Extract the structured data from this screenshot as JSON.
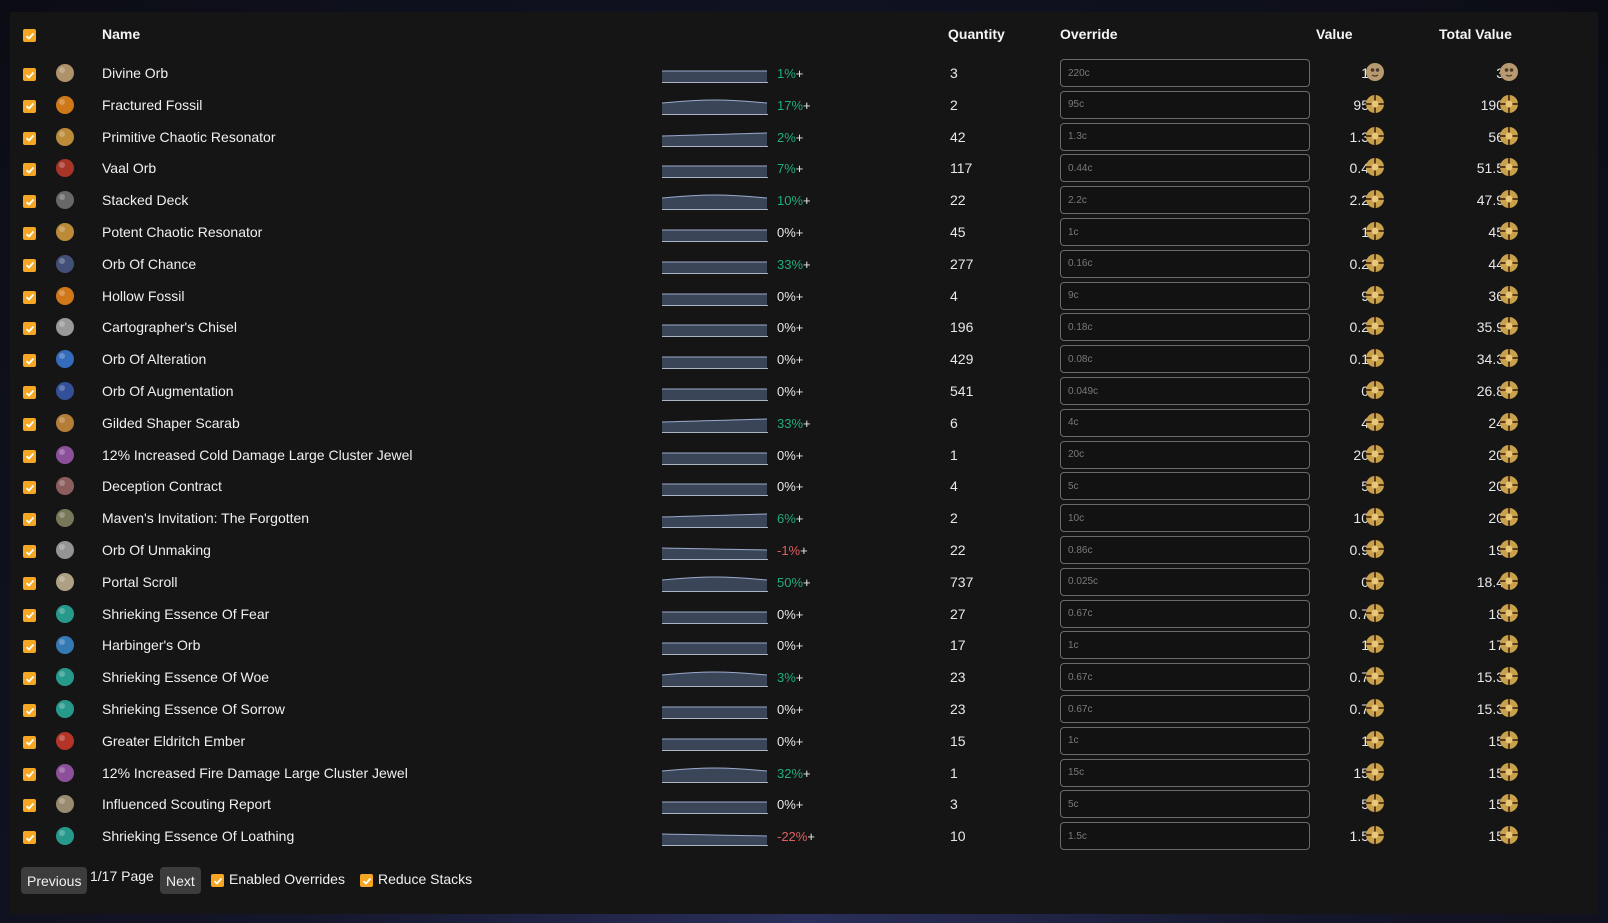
{
  "header": {
    "name": "Name",
    "quantity": "Quantity",
    "override": "Override",
    "value": "Value",
    "total_value": "Total Value"
  },
  "colors": {
    "accent": "#f5a623",
    "positive": "#1fae7a",
    "negative": "#e05d5d"
  },
  "rows": [
    {
      "name": "Divine Orb",
      "icon": "divine-orb-icon",
      "change": "1%",
      "trend": "pos",
      "qty": "3",
      "override": "220c",
      "value": "1",
      "vcur": "divine",
      "total": "3",
      "tcur": "divine"
    },
    {
      "name": "Fractured Fossil",
      "icon": "fossil-icon",
      "change": "17%",
      "trend": "pos",
      "qty": "2",
      "override": "95c",
      "value": "95",
      "vcur": "chaos",
      "total": "190",
      "tcur": "chaos"
    },
    {
      "name": "Primitive Chaotic Resonator",
      "icon": "resonator-icon",
      "change": "2%",
      "trend": "pos",
      "qty": "42",
      "override": "1.3c",
      "value": "1.3",
      "vcur": "chaos",
      "total": "56",
      "tcur": "chaos"
    },
    {
      "name": "Vaal Orb",
      "icon": "vaal-orb-icon",
      "change": "7%",
      "trend": "pos",
      "qty": "117",
      "override": "0.44c",
      "value": "0.4",
      "vcur": "chaos",
      "total": "51.5",
      "tcur": "chaos"
    },
    {
      "name": "Stacked Deck",
      "icon": "card-deck-icon",
      "change": "10%",
      "trend": "pos",
      "qty": "22",
      "override": "2.2c",
      "value": "2.2",
      "vcur": "chaos",
      "total": "47.9",
      "tcur": "chaos"
    },
    {
      "name": "Potent Chaotic Resonator",
      "icon": "resonator-icon",
      "change": "0%",
      "trend": "neu",
      "qty": "45",
      "override": "1c",
      "value": "1",
      "vcur": "chaos",
      "total": "45",
      "tcur": "chaos"
    },
    {
      "name": "Orb Of Chance",
      "icon": "chance-orb-icon",
      "change": "33%",
      "trend": "pos",
      "qty": "277",
      "override": "0.16c",
      "value": "0.2",
      "vcur": "chaos",
      "total": "44",
      "tcur": "chaos"
    },
    {
      "name": "Hollow Fossil",
      "icon": "fossil-icon",
      "change": "0%",
      "trend": "neu",
      "qty": "4",
      "override": "9c",
      "value": "9",
      "vcur": "chaos",
      "total": "36",
      "tcur": "chaos"
    },
    {
      "name": "Cartographer's Chisel",
      "icon": "chisel-icon",
      "change": "0%",
      "trend": "neu",
      "qty": "196",
      "override": "0.18c",
      "value": "0.2",
      "vcur": "chaos",
      "total": "35.9",
      "tcur": "chaos"
    },
    {
      "name": "Orb Of Alteration",
      "icon": "alteration-orb-icon",
      "change": "0%",
      "trend": "neu",
      "qty": "429",
      "override": "0.08c",
      "value": "0.1",
      "vcur": "chaos",
      "total": "34.3",
      "tcur": "chaos"
    },
    {
      "name": "Orb Of Augmentation",
      "icon": "augmentation-orb-icon",
      "change": "0%",
      "trend": "neu",
      "qty": "541",
      "override": "0.049c",
      "value": "0",
      "vcur": "chaos",
      "total": "26.8",
      "tcur": "chaos"
    },
    {
      "name": "Gilded Shaper Scarab",
      "icon": "scarab-icon",
      "change": "33%",
      "trend": "pos",
      "qty": "6",
      "override": "4c",
      "value": "4",
      "vcur": "chaos",
      "total": "24",
      "tcur": "chaos"
    },
    {
      "name": "12% Increased Cold Damage Large Cluster Jewel",
      "icon": "cluster-jewel-icon",
      "change": "0%",
      "trend": "neu",
      "qty": "1",
      "override": "20c",
      "value": "20",
      "vcur": "chaos",
      "total": "20",
      "tcur": "chaos"
    },
    {
      "name": "Deception Contract",
      "icon": "contract-icon",
      "change": "0%",
      "trend": "neu",
      "qty": "4",
      "override": "5c",
      "value": "5",
      "vcur": "chaos",
      "total": "20",
      "tcur": "chaos"
    },
    {
      "name": "Maven's Invitation: The Forgotten",
      "icon": "invitation-icon",
      "change": "6%",
      "trend": "pos",
      "qty": "2",
      "override": "10c",
      "value": "10",
      "vcur": "chaos",
      "total": "20",
      "tcur": "chaos"
    },
    {
      "name": "Orb Of Unmaking",
      "icon": "unmaking-orb-icon",
      "change": "-1%",
      "trend": "neg",
      "qty": "22",
      "override": "0.86c",
      "value": "0.9",
      "vcur": "chaos",
      "total": "19",
      "tcur": "chaos"
    },
    {
      "name": "Portal Scroll",
      "icon": "scroll-icon",
      "change": "50%",
      "trend": "pos",
      "qty": "737",
      "override": "0.025c",
      "value": "0",
      "vcur": "chaos",
      "total": "18.4",
      "tcur": "chaos"
    },
    {
      "name": "Shrieking Essence Of Fear",
      "icon": "essence-icon",
      "change": "0%",
      "trend": "neu",
      "qty": "27",
      "override": "0.67c",
      "value": "0.7",
      "vcur": "chaos",
      "total": "18",
      "tcur": "chaos"
    },
    {
      "name": "Harbinger's Orb",
      "icon": "harbinger-orb-icon",
      "change": "0%",
      "trend": "neu",
      "qty": "17",
      "override": "1c",
      "value": "1",
      "vcur": "chaos",
      "total": "17",
      "tcur": "chaos"
    },
    {
      "name": "Shrieking Essence Of Woe",
      "icon": "essence-icon",
      "change": "3%",
      "trend": "pos",
      "qty": "23",
      "override": "0.67c",
      "value": "0.7",
      "vcur": "chaos",
      "total": "15.3",
      "tcur": "chaos"
    },
    {
      "name": "Shrieking Essence Of Sorrow",
      "icon": "essence-icon",
      "change": "0%",
      "trend": "neu",
      "qty": "23",
      "override": "0.67c",
      "value": "0.7",
      "vcur": "chaos",
      "total": "15.3",
      "tcur": "chaos"
    },
    {
      "name": "Greater Eldritch Ember",
      "icon": "ember-icon",
      "change": "0%",
      "trend": "neu",
      "qty": "15",
      "override": "1c",
      "value": "1",
      "vcur": "chaos",
      "total": "15",
      "tcur": "chaos"
    },
    {
      "name": "12% Increased Fire Damage Large Cluster Jewel",
      "icon": "cluster-jewel-icon",
      "change": "32%",
      "trend": "pos",
      "qty": "1",
      "override": "15c",
      "value": "15",
      "vcur": "chaos",
      "total": "15",
      "tcur": "chaos"
    },
    {
      "name": "Influenced Scouting Report",
      "icon": "scouting-report-icon",
      "change": "0%",
      "trend": "neu",
      "qty": "3",
      "override": "5c",
      "value": "5",
      "vcur": "chaos",
      "total": "15",
      "tcur": "chaos"
    },
    {
      "name": "Shrieking Essence Of Loathing",
      "icon": "essence-icon",
      "change": "-22%",
      "trend": "neg",
      "qty": "10",
      "override": "1.5c",
      "value": "1.5",
      "vcur": "chaos",
      "total": "15",
      "tcur": "chaos"
    }
  ],
  "footer": {
    "previous": "Previous",
    "page": "1/17 Page",
    "next": "Next",
    "enabled_overrides": "Enabled Overrides",
    "reduce_stacks": "Reduce Stacks"
  }
}
